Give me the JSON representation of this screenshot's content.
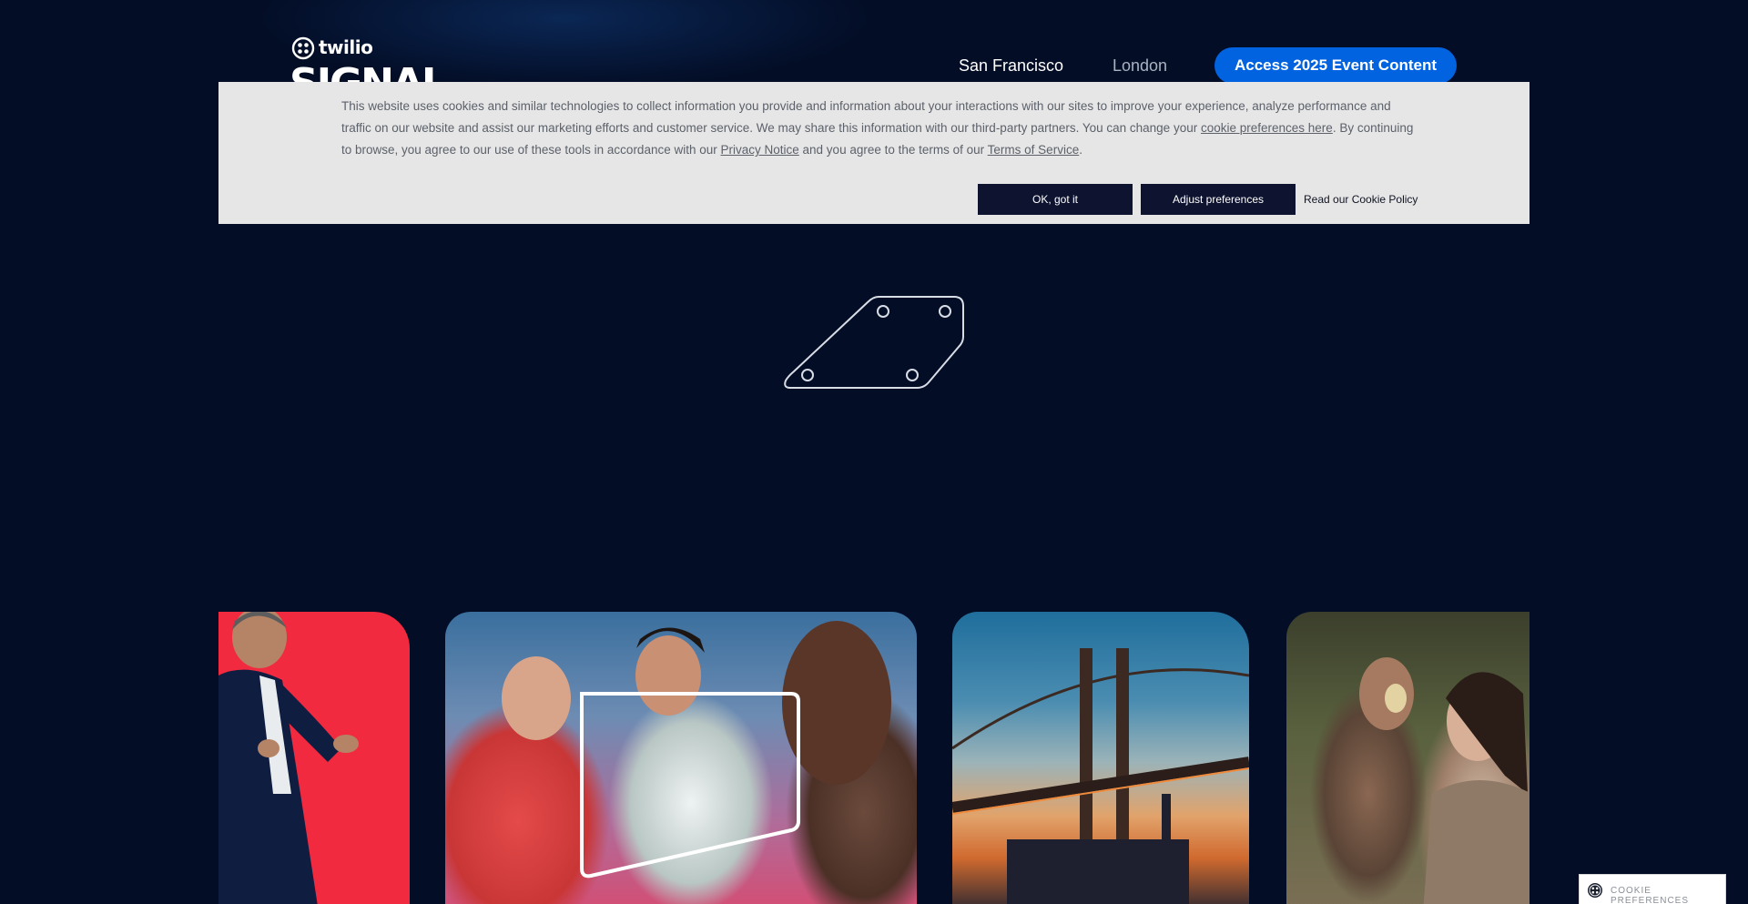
{
  "header": {
    "brand": "twilio",
    "event_name": "SIGNAL",
    "nav": {
      "san_francisco": "San Francisco",
      "london": "London"
    },
    "cta_label": "Access 2025 Event Content"
  },
  "cookie_banner": {
    "text_part1": "This website uses cookies and similar technologies to collect information you provide and information about your interactions with our sites to improve your experience, analyze performance and traffic on our website and assist our marketing efforts and customer service. We may share this information with our third-party partners. You can change your ",
    "cookie_prefs_link": "cookie preferences here",
    "text_part2": ". By continuing to browse, you agree to our use of these tools in accordance with our ",
    "privacy_link": "Privacy Notice",
    "text_part3": " and you agree to the terms of our ",
    "terms_link": "Terms of Service",
    "text_part4": ".",
    "ok_label": "OK, got it",
    "adjust_label": "Adjust preferences",
    "policy_label": "Read our Cookie Policy"
  },
  "cookie_pref_tab": {
    "label": "COOKIE PREFERENCES"
  },
  "colors": {
    "background": "#030d26",
    "cta_blue": "#0263e0",
    "banner_bg": "#e6e6e7",
    "banner_button": "#0e1330",
    "speaker_red": "#f12a40"
  }
}
